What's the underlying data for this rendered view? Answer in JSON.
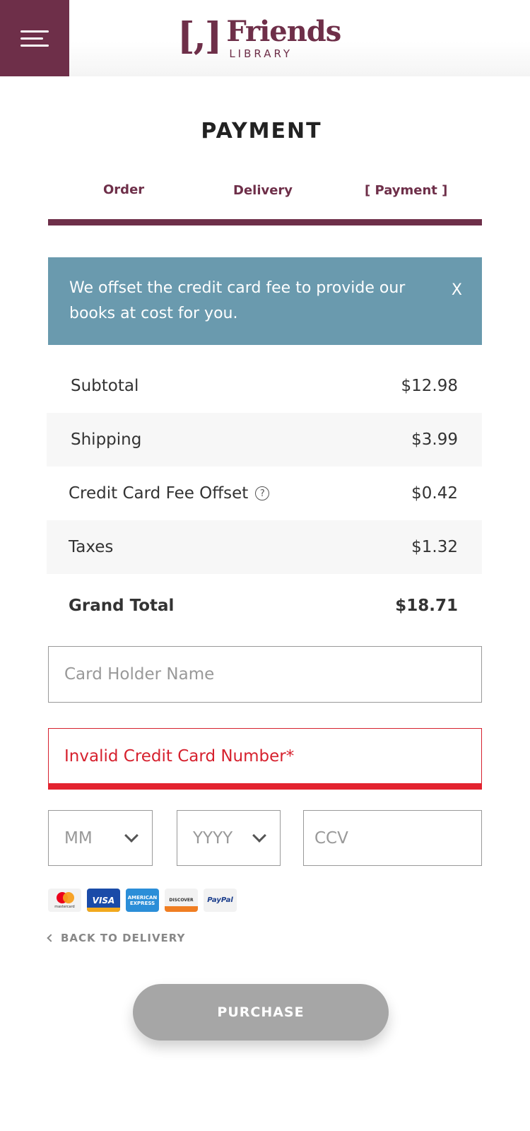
{
  "header": {
    "logo_bracket": "[,]",
    "logo_name": "Friends",
    "logo_sub": "LIBRARY"
  },
  "page": {
    "title": "PAYMENT"
  },
  "steps": [
    {
      "label": "Order"
    },
    {
      "label": "Delivery"
    },
    {
      "label": "[ Payment ]"
    }
  ],
  "alert": {
    "text": "We offset the credit card fee to provide our books at cost for you.",
    "close": "X"
  },
  "totals": {
    "subtotal": {
      "label": "Subtotal",
      "value": "$12.98"
    },
    "shipping": {
      "label": "Shipping",
      "value": "$3.99"
    },
    "fee": {
      "label": "Credit Card Fee Offset",
      "value": "$0.42",
      "help": "?"
    },
    "taxes": {
      "label": "Taxes",
      "value": "$1.32"
    },
    "grand": {
      "label": "Grand Total",
      "value": "$18.71"
    }
  },
  "form": {
    "name_placeholder": "Card Holder Name",
    "card_error": "Invalid Credit Card Number*",
    "month_placeholder": "MM",
    "year_placeholder": "YYYY",
    "ccv_placeholder": "CCV"
  },
  "payment_methods": {
    "mastercard": "mastercard",
    "visa": "VISA",
    "amex": "AMERICAN EXPRESS",
    "discover": "DISCOVER",
    "paypal": "PayPal"
  },
  "actions": {
    "back": "BACK TO DELIVERY",
    "purchase": "PURCHASE"
  },
  "colors": {
    "brand": "#6e2f49",
    "alert": "#6a9aae",
    "error": "#d6212e",
    "disabled_button": "#a6a6a6"
  }
}
